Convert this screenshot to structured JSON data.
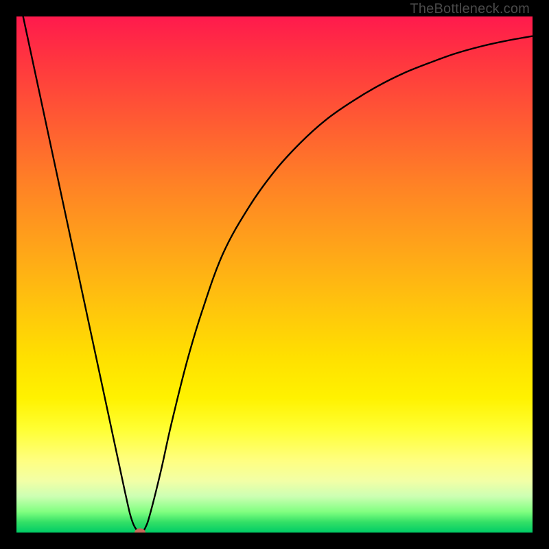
{
  "watermark": "TheBottleneck.com",
  "colors": {
    "frame": "#000000",
    "marker": "#c56a5a",
    "curve": "#000000"
  },
  "chart_data": {
    "type": "line",
    "title": "",
    "xlabel": "",
    "ylabel": "",
    "xlim": [
      0,
      100
    ],
    "ylim": [
      0,
      100
    ],
    "grid": false,
    "series": [
      {
        "name": "bottleneck-curve",
        "x": [
          0,
          3,
          6,
          9,
          12,
          15,
          18,
          21,
          22.5,
          24,
          25,
          26,
          28,
          30,
          33,
          36,
          40,
          45,
          50,
          55,
          60,
          65,
          70,
          75,
          80,
          85,
          90,
          95,
          100
        ],
        "y": [
          106,
          92,
          78,
          64,
          50,
          36,
          22,
          8,
          2,
          0,
          1,
          4,
          12,
          21,
          33,
          43,
          54,
          63,
          70,
          75.5,
          80,
          83.5,
          86.5,
          89,
          91,
          92.8,
          94.2,
          95.3,
          96.2
        ]
      }
    ],
    "marker": {
      "x": 24,
      "y": 0
    },
    "gradient_stops": [
      {
        "pos": 0,
        "color": "#ff1a4d"
      },
      {
        "pos": 50,
        "color": "#ffc000"
      },
      {
        "pos": 82,
        "color": "#ffff66"
      },
      {
        "pos": 100,
        "color": "#00cc66"
      }
    ]
  }
}
